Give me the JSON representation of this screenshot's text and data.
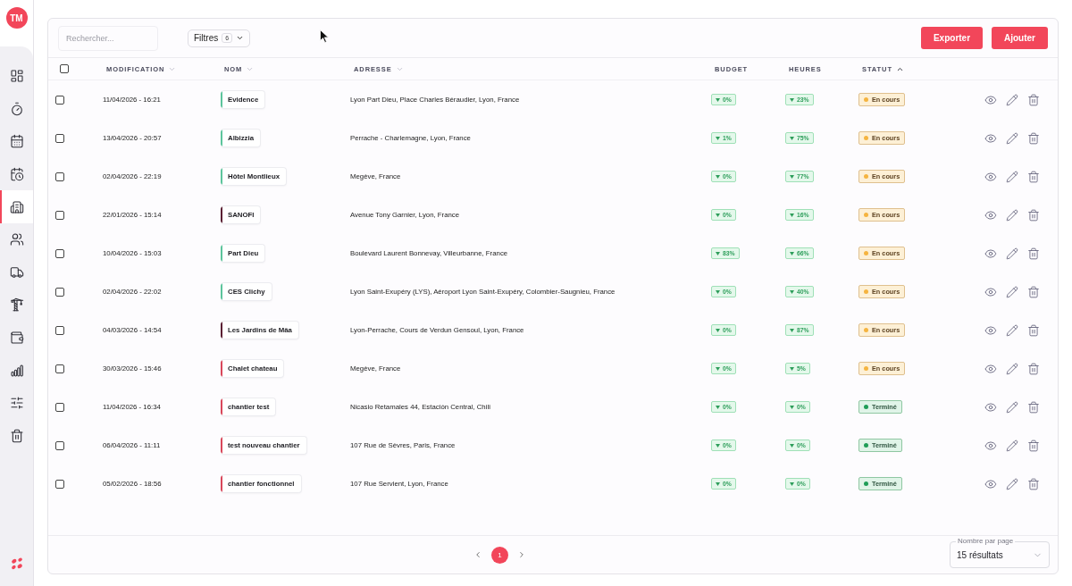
{
  "sidebar": {
    "avatar": "TM",
    "items": [
      {
        "selected": false
      },
      {
        "selected": false
      },
      {
        "selected": false
      },
      {
        "selected": false
      },
      {
        "selected": true
      },
      {
        "selected": false
      },
      {
        "selected": false
      },
      {
        "selected": false
      },
      {
        "selected": false
      },
      {
        "selected": false
      },
      {
        "selected": false
      },
      {
        "selected": false
      }
    ]
  },
  "toolbar": {
    "search": {
      "placeholder": "Rechercher..."
    },
    "filters": {
      "label": "Filtres",
      "count": "6"
    },
    "buttons": [
      "Exporter",
      "Ajouter"
    ]
  },
  "table": {
    "select_all": {
      "checked": false
    },
    "columns": [
      {
        "label": "MODIFICATION",
        "sortable": true,
        "sorted": false
      },
      {
        "label": "NOM",
        "sortable": true,
        "sorted": false
      },
      {
        "label": "ADRESSE",
        "sortable": true,
        "sorted": false
      },
      {
        "label": "BUDGET",
        "sortable": false,
        "sorted": false
      },
      {
        "label": "HEURES",
        "sortable": false,
        "sorted": false
      },
      {
        "label": "STATUT",
        "sortable": true,
        "sorted": true
      }
    ],
    "rows": [
      {
        "checked": false,
        "modified": "11/04/2026 - 16:21",
        "name": "Evidence",
        "color": "#5cc49c",
        "address": "Lyon Part Dieu, Place Charles Béraudier, Lyon, France",
        "budget": "0%",
        "hours": "23%",
        "status": {
          "kind": "in_progress",
          "label": "En cours"
        }
      },
      {
        "checked": false,
        "modified": "13/04/2026 - 20:57",
        "name": "Albizzia",
        "color": "#5cc49c",
        "address": "Perrache - Charlemagne, Lyon, France",
        "budget": "1%",
        "hours": "75%",
        "status": {
          "kind": "in_progress",
          "label": "En cours"
        }
      },
      {
        "checked": false,
        "modified": "02/04/2026 - 22:19",
        "name": "Hôtel Montlieux",
        "color": "#5cc49c",
        "address": "Megève, France",
        "budget": "0%",
        "hours": "77%",
        "status": {
          "kind": "in_progress",
          "label": "En cours"
        }
      },
      {
        "checked": false,
        "modified": "22/01/2026 - 15:14",
        "name": "SANOFI",
        "color": "#5a1f32",
        "address": "Avenue Tony Garnier, Lyon, France",
        "budget": "0%",
        "hours": "16%",
        "status": {
          "kind": "in_progress",
          "label": "En cours"
        }
      },
      {
        "checked": false,
        "modified": "10/04/2026 - 15:03",
        "name": "Part Dieu",
        "color": "#5cc49c",
        "address": "Boulevard Laurent Bonnevay, Villeurbanne, France",
        "budget": "83%",
        "hours": "66%",
        "status": {
          "kind": "in_progress",
          "label": "En cours"
        }
      },
      {
        "checked": false,
        "modified": "02/04/2026 - 22:02",
        "name": "CES Clichy",
        "color": "#5cc49c",
        "address": "Lyon Saint-Exupéry (LYS), Aéroport Lyon Saint-Exupéry, Colombier-Saugnieu, France",
        "budget": "0%",
        "hours": "40%",
        "status": {
          "kind": "in_progress",
          "label": "En cours"
        }
      },
      {
        "checked": false,
        "modified": "04/03/2026 - 14:54",
        "name": "Les Jardins de Mâa",
        "color": "#5a1f32",
        "address": "Lyon-Perrache, Cours de Verdun Gensoul, Lyon, France",
        "budget": "0%",
        "hours": "87%",
        "status": {
          "kind": "in_progress",
          "label": "En cours"
        }
      },
      {
        "checked": false,
        "modified": "30/03/2026 - 15:46",
        "name": "Chalet chateau",
        "color": "#d9475a",
        "address": "Megève, France",
        "budget": "0%",
        "hours": "5%",
        "status": {
          "kind": "in_progress",
          "label": "En cours"
        }
      },
      {
        "checked": false,
        "modified": "11/04/2026 - 16:34",
        "name": "chantier test",
        "color": "#d9475a",
        "address": "Nicasio Retamales 44, Estación Central, Chili",
        "budget": "0%",
        "hours": "0%",
        "status": {
          "kind": "done",
          "label": "Terminé"
        }
      },
      {
        "checked": false,
        "modified": "06/04/2026 - 11:11",
        "name": "test nouveau chantier",
        "color": "#d9475a",
        "address": "107 Rue de Sèvres, Paris, France",
        "budget": "0%",
        "hours": "0%",
        "status": {
          "kind": "done",
          "label": "Terminé"
        }
      },
      {
        "checked": false,
        "modified": "05/02/2026 - 18:56",
        "name": "chantier fonctionnel",
        "color": "#d9475a",
        "address": "107 Rue Servient, Lyon, France",
        "budget": "0%",
        "hours": "0%",
        "status": {
          "kind": "done",
          "label": "Terminé"
        }
      }
    ]
  },
  "pagination": {
    "pages": [
      {
        "label": "1",
        "selected": true
      }
    ]
  },
  "page_size": {
    "label": "Nombre par page",
    "value": "15 résultats"
  }
}
